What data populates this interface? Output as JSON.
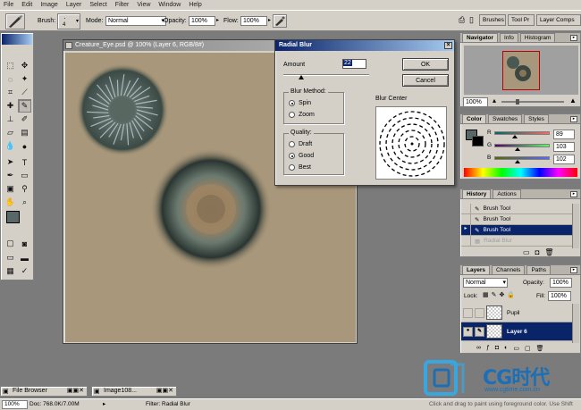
{
  "menubar": {
    "items": [
      "File",
      "Edit",
      "Image",
      "Layer",
      "Select",
      "Filter",
      "View",
      "Window",
      "Help"
    ]
  },
  "options_bar": {
    "brush_label": "Brush:",
    "brush_size": "4",
    "mode_label": "Mode:",
    "mode_value": "Normal",
    "opacity_label": "Opacity:",
    "opacity_value": "100%",
    "flow_label": "Flow:",
    "flow_value": "100%",
    "wells": [
      "Brushes",
      "Tool Pr",
      "Layer Comps"
    ]
  },
  "document": {
    "title": "Creature_Eye.psd @ 100% (Layer 6, RGB/8#)",
    "canvas_color": "#a8977a"
  },
  "radial_blur_dialog": {
    "title": "Radial Blur",
    "amount_label": "Amount",
    "amount_value": "22",
    "ok_label": "OK",
    "cancel_label": "Cancel",
    "blur_method_label": "Blur Method:",
    "blur_methods": [
      "Spin",
      "Zoom"
    ],
    "blur_method_selected": "Spin",
    "quality_label": "Quality:",
    "qualities": [
      "Draft",
      "Good",
      "Best"
    ],
    "quality_selected": "Good",
    "blur_center_label": "Blur Center"
  },
  "navigator_panel": {
    "tabs": [
      "Navigator",
      "Info",
      "Histogram"
    ],
    "zoom_value": "100%"
  },
  "color_panel": {
    "tabs": [
      "Color",
      "Swatches",
      "Styles"
    ],
    "channels": [
      {
        "label": "R",
        "value": "89",
        "fraction": 0.35
      },
      {
        "label": "G",
        "value": "103",
        "fraction": 0.4
      },
      {
        "label": "B",
        "value": "102",
        "fraction": 0.4
      }
    ]
  },
  "history_panel": {
    "tabs": [
      "History",
      "Actions"
    ],
    "items": [
      {
        "label": "Brush Tool",
        "state": "normal"
      },
      {
        "label": "Brush Tool",
        "state": "normal"
      },
      {
        "label": "Brush Tool",
        "state": "active"
      },
      {
        "label": "Radial Blur",
        "state": "dim"
      }
    ]
  },
  "layers_panel": {
    "tabs": [
      "Layers",
      "Channels",
      "Paths"
    ],
    "blend_mode": "Normal",
    "opacity_label": "Opacity:",
    "opacity_value": "100%",
    "lock_label": "Lock:",
    "fill_label": "Fill:",
    "fill_value": "100%",
    "layers": [
      {
        "name": "Pupil",
        "active": false
      },
      {
        "name": "Layer 6",
        "active": true
      }
    ]
  },
  "doc_tabs": [
    {
      "label": "File Browser"
    },
    {
      "label": "Image108..."
    }
  ],
  "status_bar": {
    "zoom": "100%",
    "doc_size": "Doc: 768.0K/7.00M",
    "filter": "Filter: Radial Blur",
    "hint": "Click and drag to paint using foreground color.  Use Shift"
  },
  "watermark": {
    "brand_cn": "CG时代",
    "url": "www.cgtime.com.cn"
  },
  "colors": {
    "accent": "#0a246a",
    "panel_bg": "#d4d0c8",
    "workspace": "#7b7b7b",
    "foreground_swatch": "#596766"
  }
}
